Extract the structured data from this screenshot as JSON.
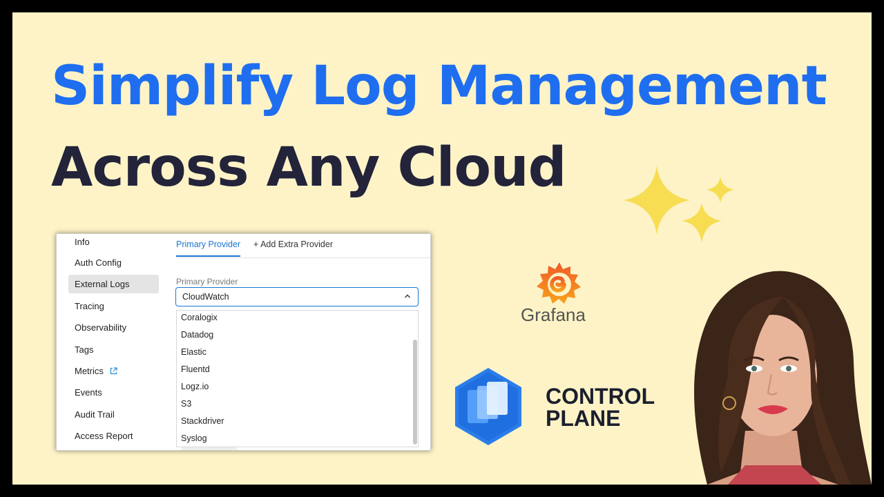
{
  "headline": {
    "line1": "Simplify Log Management",
    "line2": "Across Any Cloud"
  },
  "screenshot": {
    "sidebar": {
      "items": [
        {
          "label": "Info",
          "active": false
        },
        {
          "label": "Auth Config",
          "active": false
        },
        {
          "label": "External Logs",
          "active": true
        },
        {
          "label": "Tracing",
          "active": false
        },
        {
          "label": "Observability",
          "active": false
        },
        {
          "label": "Tags",
          "active": false
        },
        {
          "label": "Metrics",
          "active": false,
          "icon": "external-link-icon"
        },
        {
          "label": "Events",
          "active": false
        },
        {
          "label": "Audit Trail",
          "active": false
        },
        {
          "label": "Access Report",
          "active": false
        }
      ]
    },
    "tabs": {
      "primary": "Primary Provider",
      "extra": "+ Add Extra Provider"
    },
    "field_label": "Primary Provider",
    "select_value": "CloudWatch",
    "options": [
      "Coralogix",
      "Datadog",
      "Elastic",
      "Fluentd",
      "Logz.io",
      "S3",
      "Stackdriver",
      "Syslog"
    ]
  },
  "logos": {
    "grafana": "Grafana",
    "control_plane_line1": "CONTROL",
    "control_plane_line2": "PLANE"
  },
  "colors": {
    "background": "#fdf3c7",
    "headline_blue": "#1f6ef0",
    "headline_dark": "#23233a",
    "accent_blue": "#1976d2",
    "sparkle": "#f7dd52"
  }
}
